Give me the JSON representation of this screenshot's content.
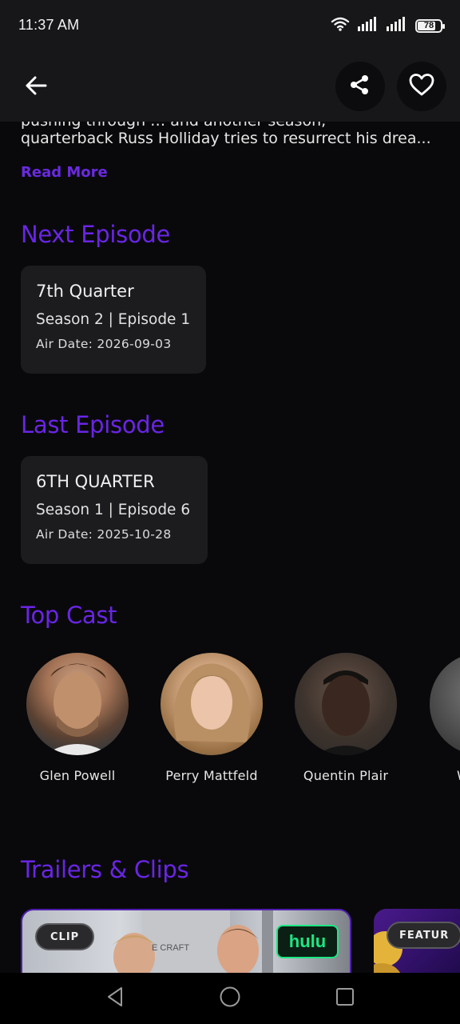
{
  "status_bar": {
    "time": "11:37 AM",
    "battery": "78",
    "battery_level": 0.78,
    "icons": [
      "wifi-icon",
      "signal-icon",
      "signal-icon",
      "battery-icon"
    ]
  },
  "app_bar": {
    "icons": [
      "arrow-left-icon",
      "share-icon",
      "heart-outline-icon"
    ]
  },
  "overview": {
    "clipped_line": "pushing through … and another season,",
    "line": "quarterback Russ Holliday tries to resurrect his drea...",
    "read_more": "Read More"
  },
  "next_episode": {
    "heading": "Next Episode",
    "title": "7th Quarter",
    "season_episode": "Season 2 | Episode 1",
    "air_date": "Air Date: 2026-09-03"
  },
  "last_episode": {
    "heading": "Last Episode",
    "title": "6TH QUARTER",
    "season_episode": "Season 1 | Episode 6",
    "air_date": "Air Date: 2025-10-28"
  },
  "top_cast": {
    "heading": "Top Cast",
    "members": [
      {
        "name": "Glen Powell"
      },
      {
        "name": "Perry Mattfeld"
      },
      {
        "name": "Quentin Plair"
      },
      {
        "name": "W"
      }
    ]
  },
  "trailers": {
    "heading": "Trailers & Clips",
    "items": [
      {
        "badge": "CLIP",
        "brand": "hulu"
      },
      {
        "badge": "FEATUR"
      }
    ]
  },
  "colors": {
    "accent": "#6a25e6",
    "background": "#09090b",
    "card": "#1c1c1f",
    "hulu_green": "#1ce783"
  },
  "nav_bar": {
    "icons": [
      "back-triangle-icon",
      "home-circle-icon",
      "recents-square-icon"
    ]
  }
}
